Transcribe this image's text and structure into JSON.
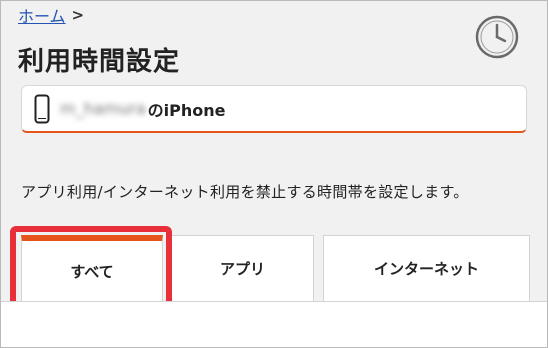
{
  "breadcrumb": {
    "home_label": "ホーム",
    "separator": ">"
  },
  "page": {
    "title": "利用時間設定",
    "description": "アプリ利用/インターネット利用を禁止する時間帯を設定します。"
  },
  "device": {
    "user_name": "m_hamura",
    "device_suffix": "のiPhone",
    "icon": "smartphone-icon"
  },
  "header_icon": "clock-icon",
  "tabs": [
    {
      "label": "すべて",
      "selected": true
    },
    {
      "label": "アプリ",
      "selected": false
    },
    {
      "label": "インターネット",
      "selected": false
    }
  ],
  "colors": {
    "accent": "#e5541b",
    "highlight": "#e8303a",
    "link": "#2454b4",
    "background": "#f1f1f1"
  }
}
